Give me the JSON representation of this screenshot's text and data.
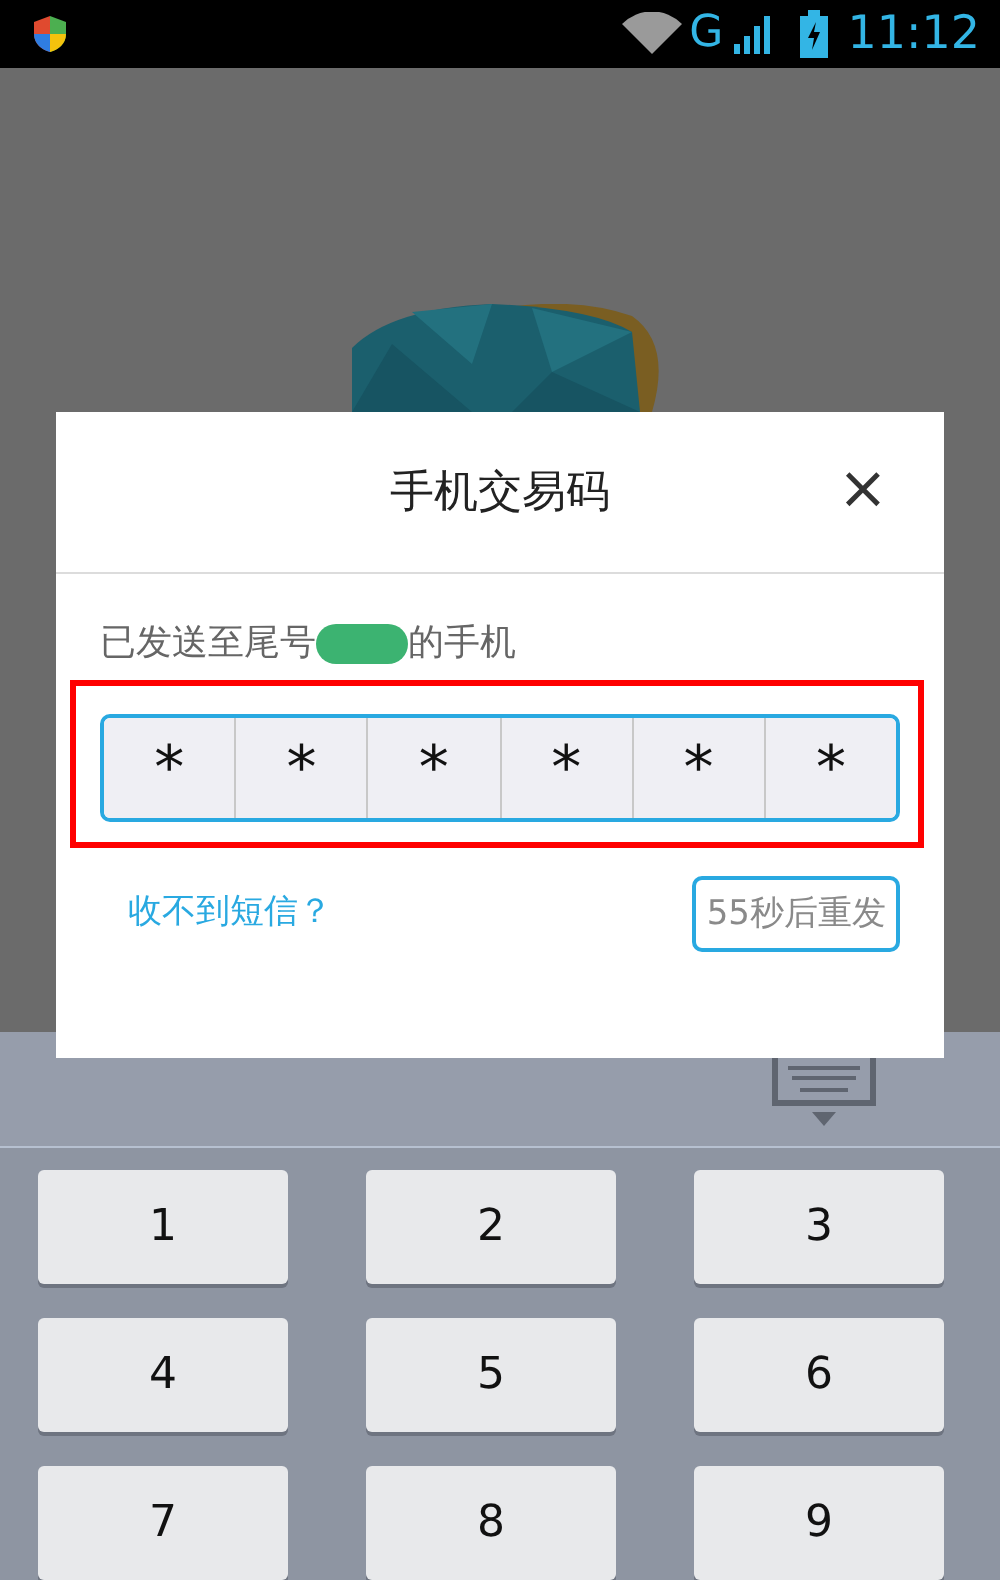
{
  "status_bar": {
    "network": "G",
    "time": "11:12"
  },
  "dialog": {
    "title": "手机交易码",
    "close": "×",
    "message_before": "已发送至尾号",
    "message_after": "的手机",
    "code_cells": [
      "*",
      "*",
      "*",
      "*",
      "*",
      "*"
    ],
    "help_link": "收不到短信？",
    "resend_button": {
      "label": "55秒后重发",
      "disabled": true
    }
  },
  "keyboard": {
    "keys": [
      "1",
      "2",
      "3",
      "4",
      "5",
      "6",
      "7",
      "8",
      "9"
    ]
  }
}
